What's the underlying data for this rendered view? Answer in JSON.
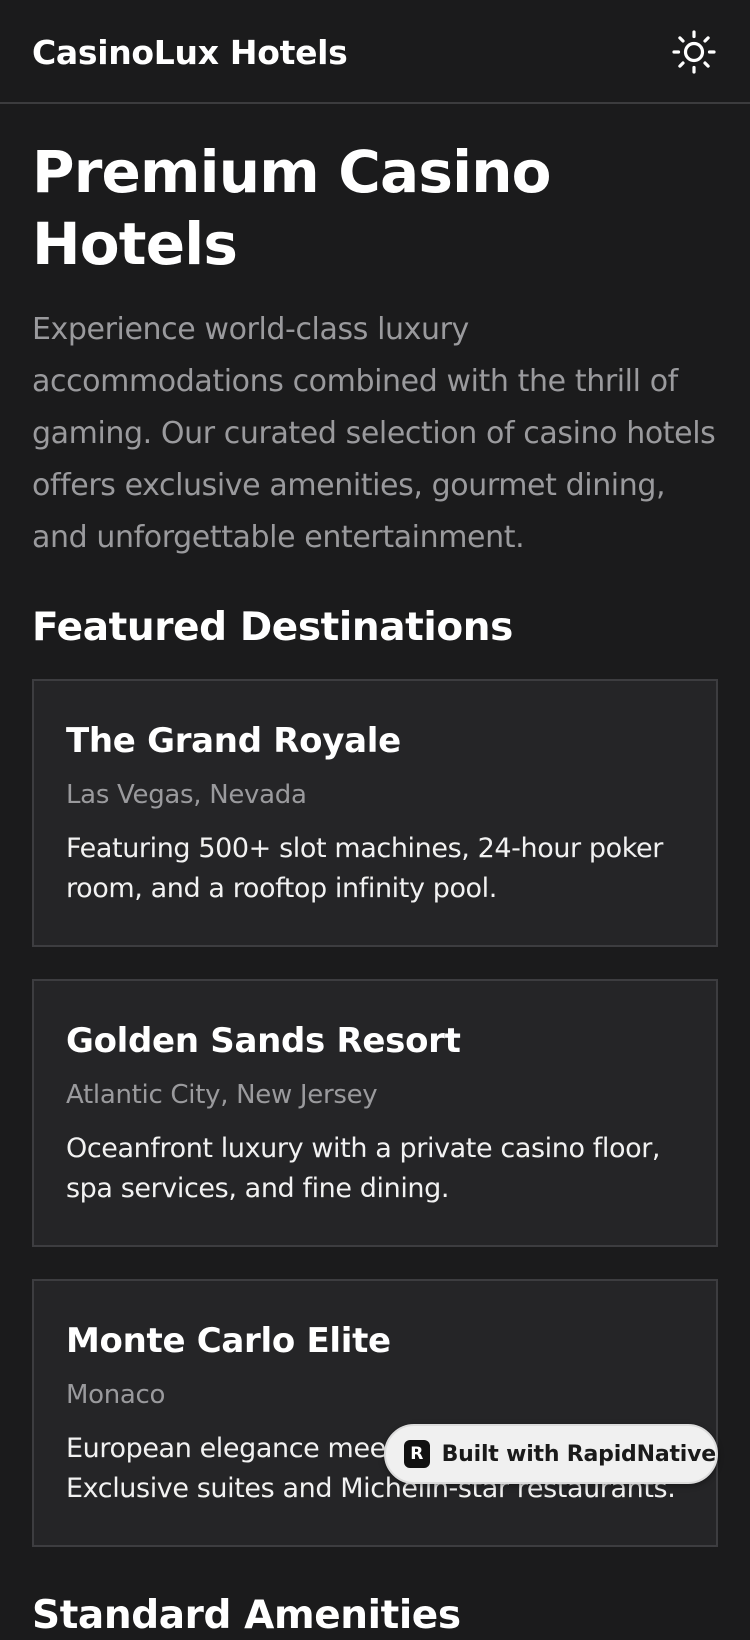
{
  "header": {
    "app_title": "CasinoLux Hotels",
    "theme_icon": "sun-icon"
  },
  "hero": {
    "title": "Premium Casino Hotels",
    "description": "Experience world-class luxury accommodations combined with the thrill of gaming. Our curated selection of casino hotels offers exclusive amenities, gourmet dining, and unforgettable entertainment."
  },
  "featured": {
    "heading": "Featured Destinations",
    "hotels": [
      {
        "name": "The Grand Royale",
        "location": "Las Vegas, Nevada",
        "description": "Featuring 500+ slot machines, 24-hour poker room, and a rooftop infinity pool."
      },
      {
        "name": "Golden Sands Resort",
        "location": "Atlantic City, New Jersey",
        "description": "Oceanfront luxury with a private casino floor, spa services, and fine dining."
      },
      {
        "name": "Monte Carlo Elite",
        "location": "Monaco",
        "description": "European elegance meets high-stakes gaming. Exclusive suites and Michelin-star restaurants."
      }
    ]
  },
  "amenities": {
    "heading": "Standard Amenities"
  },
  "badge": {
    "label": "Built with RapidNative",
    "logo_letter": "R",
    "icon": "rapidnative-logo-icon"
  },
  "colors": {
    "background": "#1b1b1c",
    "card": "#252527",
    "muted_text": "#9a9a9d"
  }
}
